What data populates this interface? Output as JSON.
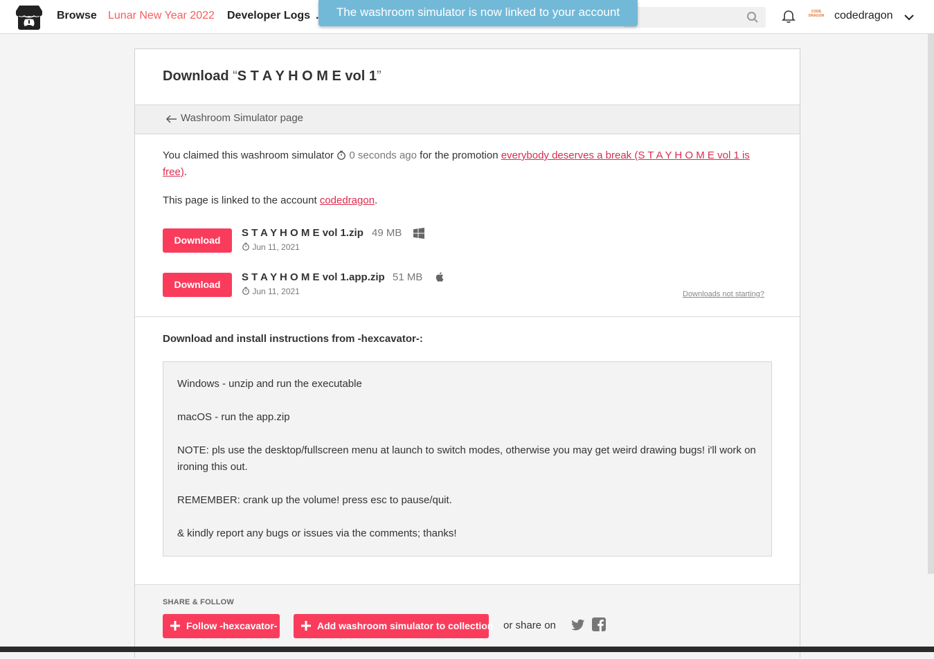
{
  "header": {
    "nav": {
      "browse": "Browse",
      "lunar": "Lunar New Year 2022",
      "devlogs": "Developer Logs",
      "more": "."
    },
    "username": "codedragon",
    "avatar_text": "CODE DRAGON"
  },
  "toast": {
    "message": "The washroom simulator is now linked to your account"
  },
  "page": {
    "title_prefix": "Download ",
    "title_open_quote": "“",
    "title_name": "S T A Y H O M E vol 1",
    "title_close_quote": "”",
    "back_link": "Washroom Simulator page",
    "claim": {
      "before": "You claimed this washroom simulator ",
      "time": "0 seconds ago",
      "middle": " for the promotion ",
      "promo": "everybody deserves a break (S T A Y H O M E vol 1 is free)",
      "after": "."
    },
    "linked": {
      "before": "This page is linked to the account ",
      "account": "codedragon",
      "after": "."
    },
    "downloads": [
      {
        "button": "Download",
        "name": "S T A Y H O M E vol 1.zip",
        "size": "49 MB",
        "date": "Jun 11, 2021",
        "os": "windows-icon"
      },
      {
        "button": "Download",
        "name": "S T A Y H O M E vol 1.app.zip",
        "size": "51 MB",
        "date": "Jun 11, 2021",
        "os": "apple-icon"
      }
    ],
    "not_starting": "Downloads not starting?",
    "instructions_heading": "Download and install instructions from -hexcavator-:",
    "instructions": [
      "Windows - unzip and run the executable",
      "macOS - run the app.zip",
      "NOTE: pls use the desktop/fullscreen menu at launch to switch modes, otherwise you may get weird drawing bugs! i'll work on ironing this out.",
      "REMEMBER: crank up the volume! press esc to pause/quit.",
      "& kindly report any bugs or issues via the comments; thanks!"
    ],
    "share": {
      "label": "SHARE & FOLLOW",
      "follow": "Follow -hexcavator-",
      "collection": "Add washroom simulator to collection",
      "share_on": "or share on"
    }
  },
  "colors": {
    "accent": "#fa3c5c",
    "link": "#da2c4d",
    "toast": "#72b9d8"
  }
}
